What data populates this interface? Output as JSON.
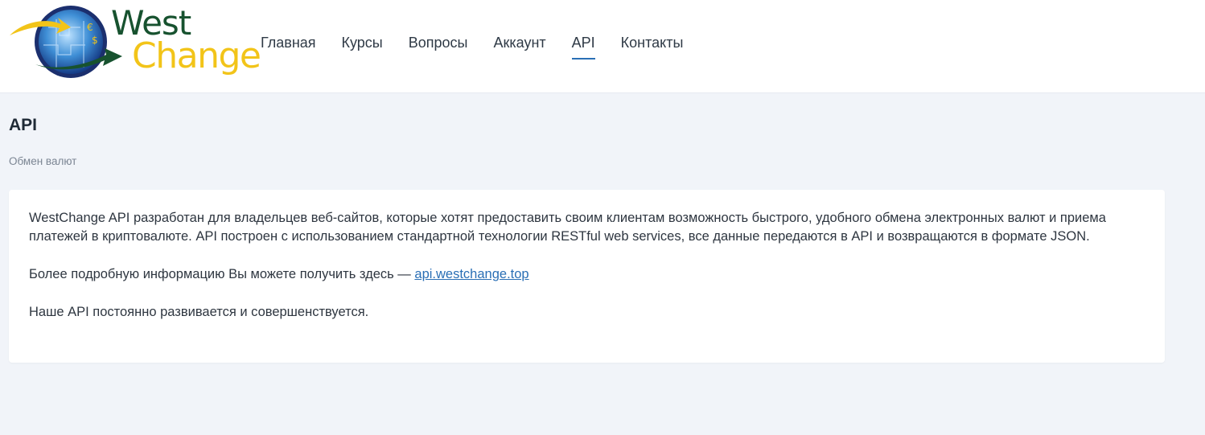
{
  "brand": {
    "name_part1": "West",
    "name_part2": "Change"
  },
  "nav": {
    "items": [
      {
        "label": "Главная"
      },
      {
        "label": "Курсы"
      },
      {
        "label": "Вопросы"
      },
      {
        "label": "Аккаунт"
      },
      {
        "label": "API",
        "active": true
      },
      {
        "label": "Контакты"
      }
    ]
  },
  "page": {
    "title": "API",
    "subtitle": "Обмен валют"
  },
  "content": {
    "paragraph1": "WestChange API разработан для владельцев веб-сайтов, которые хотят предоставить своим клиентам возможность быстрого, удобного обмена электронных валют и приема платежей в криптовалюте. API построен с использованием стандартной технологии RESTful web services, все данные передаются в API и возвращаются в формате JSON.",
    "paragraph2_prefix": "Более подробную информацию Вы можете получить здесь — ",
    "paragraph2_link": "api.westchange.top",
    "paragraph3": "Наше API постоянно развивается и совершенствуется."
  },
  "colors": {
    "accent": "#2a6fb5",
    "logo_green": "#17522f",
    "logo_yellow": "#f2c419",
    "page_bg": "#f1f4f9"
  },
  "icons": [
    "globe-logo-icon",
    "arrow-icon"
  ]
}
